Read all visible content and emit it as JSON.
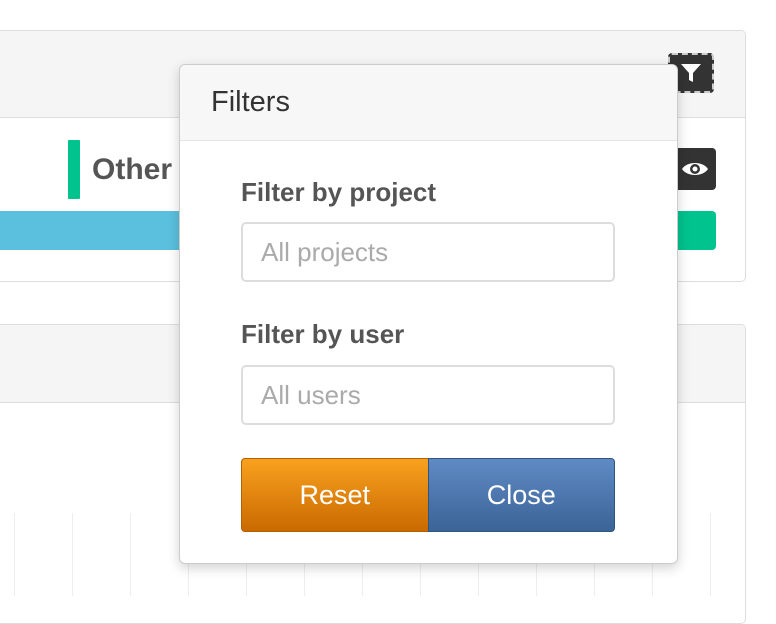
{
  "background": {
    "legend_label": "Other",
    "legend_color": "#00c38e",
    "progress_colors": {
      "primary": "#5bc0de",
      "secondary": "#00c38e"
    },
    "icons": {
      "filter_toggle": "filter-icon",
      "visibility_toggle": "eye-icon"
    }
  },
  "filters": {
    "title": "Filters",
    "project": {
      "label": "Filter by project",
      "placeholder": "All projects",
      "value": ""
    },
    "user": {
      "label": "Filter by user",
      "placeholder": "All users",
      "value": ""
    },
    "buttons": {
      "reset": "Reset",
      "close": "Close"
    },
    "colors": {
      "reset": "#e7860f",
      "close": "#4a74a8"
    }
  }
}
